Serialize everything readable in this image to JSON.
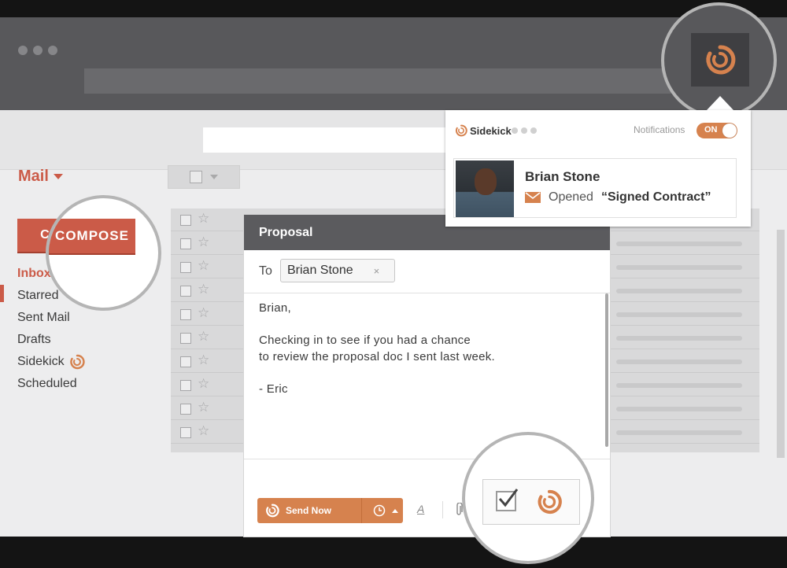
{
  "mail": {
    "title": "Mail"
  },
  "sidebar": {
    "compose_label": "COMPOSE",
    "items": [
      {
        "label": "Inbox"
      },
      {
        "label": "Starred"
      },
      {
        "label": "Sent Mail"
      },
      {
        "label": "Drafts"
      },
      {
        "label": "Sidekick"
      },
      {
        "label": "Scheduled"
      }
    ]
  },
  "compose": {
    "title": "Proposal",
    "to_label": "To",
    "recipient": "Brian Stone",
    "remove_icon": "×",
    "body": {
      "greeting": "Brian,",
      "line1": "Checking in to see if you had a chance",
      "line2": "to review the proposal doc I sent last week.",
      "signature": "- Eric"
    },
    "send_label": "Send Now",
    "format_label": "A",
    "attach_icon": "paperclip"
  },
  "popup": {
    "brand": "Sidekick",
    "notifications_label": "Notifications",
    "toggle_label": "ON",
    "contact_name": "Brian Stone",
    "action_verb": "Opened",
    "action_subject": "“Signed Contract”"
  },
  "colors": {
    "accent": "#cb5b48",
    "sidekick_orange": "#d6824e",
    "chrome": "#58585b"
  }
}
